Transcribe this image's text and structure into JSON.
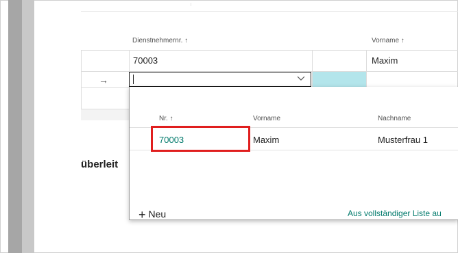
{
  "grid": {
    "headers": {
      "employee_no": "Dienstnehmernr. ↑",
      "first_name": "Vorname ↑"
    },
    "row1": {
      "employee_no": "70003",
      "first_name": "Maxim"
    },
    "row_arrow": "→"
  },
  "lookup": {
    "value": "",
    "headers": {
      "no": "Nr. ↑",
      "first_name": "Vorname",
      "last_name": "Nachname"
    },
    "rows": [
      {
        "no": "70003",
        "first_name": "Maxim",
        "last_name": "Musterfrau 1"
      }
    ],
    "new_label": "Neu",
    "full_list_label": "Aus vollständiger Liste au"
  },
  "section": {
    "partial_heading": "überleit"
  },
  "colors": {
    "highlight": "#e01e1e",
    "link": "#00796b",
    "selected_cell": "#b3e5eb"
  },
  "icons": {
    "arrow": "arrow-right-icon",
    "chevron": "chevron-down-icon",
    "plus": "plus-icon"
  }
}
